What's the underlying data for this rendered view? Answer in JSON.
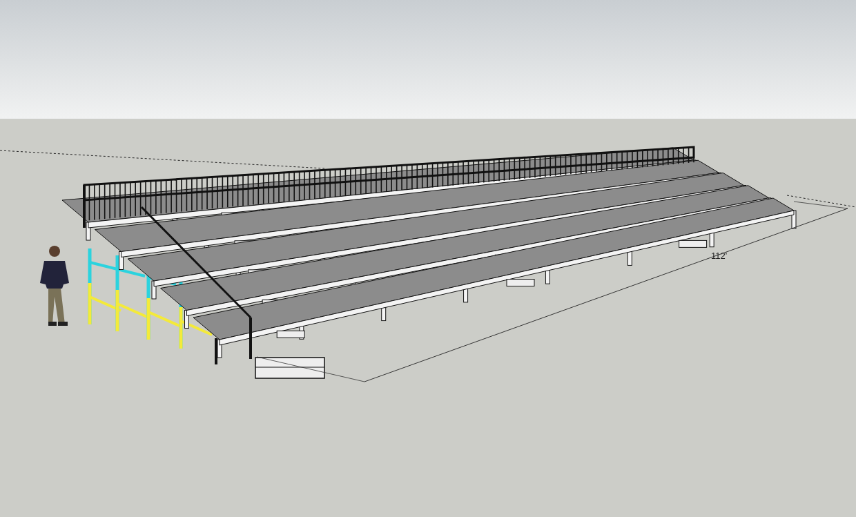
{
  "viewport": {
    "dimension": {
      "label": "112'"
    }
  }
}
